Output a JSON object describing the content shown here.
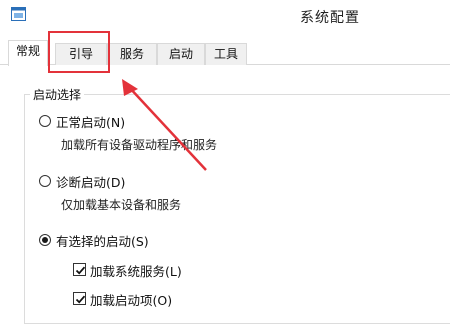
{
  "window": {
    "title": "系统配置"
  },
  "tabs": [
    {
      "label": "常规",
      "active": true
    },
    {
      "label": "引导",
      "active": false
    },
    {
      "label": "服务",
      "active": false
    },
    {
      "label": "启动",
      "active": false
    },
    {
      "label": "工具",
      "active": false
    }
  ],
  "startup": {
    "group_label": "启动选择",
    "options": [
      {
        "label": "正常启动(N)",
        "description": "加载所有设备驱动程序和服务",
        "selected": false
      },
      {
        "label": "诊断启动(D)",
        "description": "仅加载基本设备和服务",
        "selected": false
      },
      {
        "label": "有选择的启动(S)",
        "selected": true
      }
    ],
    "checkboxes": [
      {
        "label": "加载系统服务(L)",
        "checked": true
      },
      {
        "label": "加载启动项(O)",
        "checked": true
      }
    ]
  },
  "annotation": {
    "color": "#e3323a"
  }
}
